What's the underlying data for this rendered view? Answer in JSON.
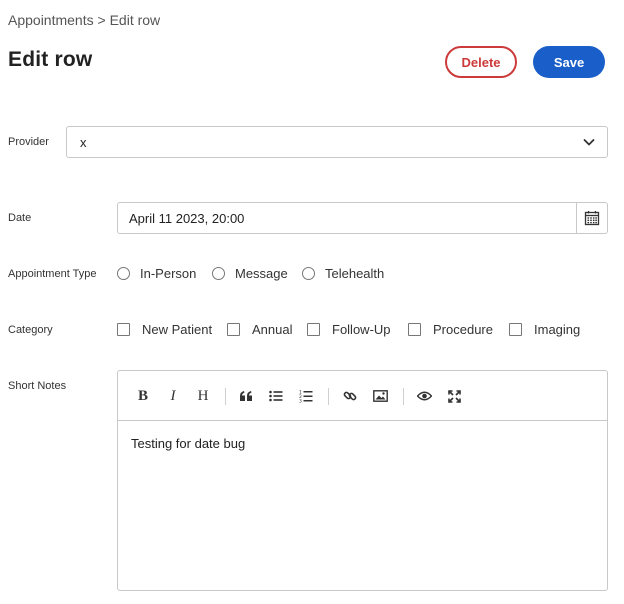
{
  "breadcrumb": {
    "parent": "Appointments",
    "separator": ">",
    "current": "Edit row"
  },
  "page_title": "Edit row",
  "actions": {
    "delete_label": "Delete",
    "save_label": "Save"
  },
  "colors": {
    "primary": "#1a5fc9",
    "danger": "#cc3a3a",
    "border": "#c8c8c8"
  },
  "provider": {
    "label": "Provider",
    "value": "x",
    "icon": "chevron-down-icon"
  },
  "date": {
    "label": "Date",
    "value": "April 11 2023, 20:00",
    "icon": "calendar-icon"
  },
  "appointment_type": {
    "label": "Appointment Type",
    "options": [
      "In-Person",
      "Message",
      "Telehealth"
    ],
    "selected": null
  },
  "category": {
    "label": "Category",
    "options": [
      "New Patient",
      "Annual",
      "Follow-Up",
      "Procedure",
      "Imaging"
    ],
    "checked": []
  },
  "short_notes": {
    "label": "Short Notes",
    "toolbar": [
      "bold-icon",
      "italic-icon",
      "heading-icon",
      "quote-icon",
      "unordered-list-icon",
      "ordered-list-icon",
      "link-icon",
      "image-icon",
      "preview-icon",
      "fullscreen-icon"
    ],
    "content": "Testing for date bug"
  }
}
